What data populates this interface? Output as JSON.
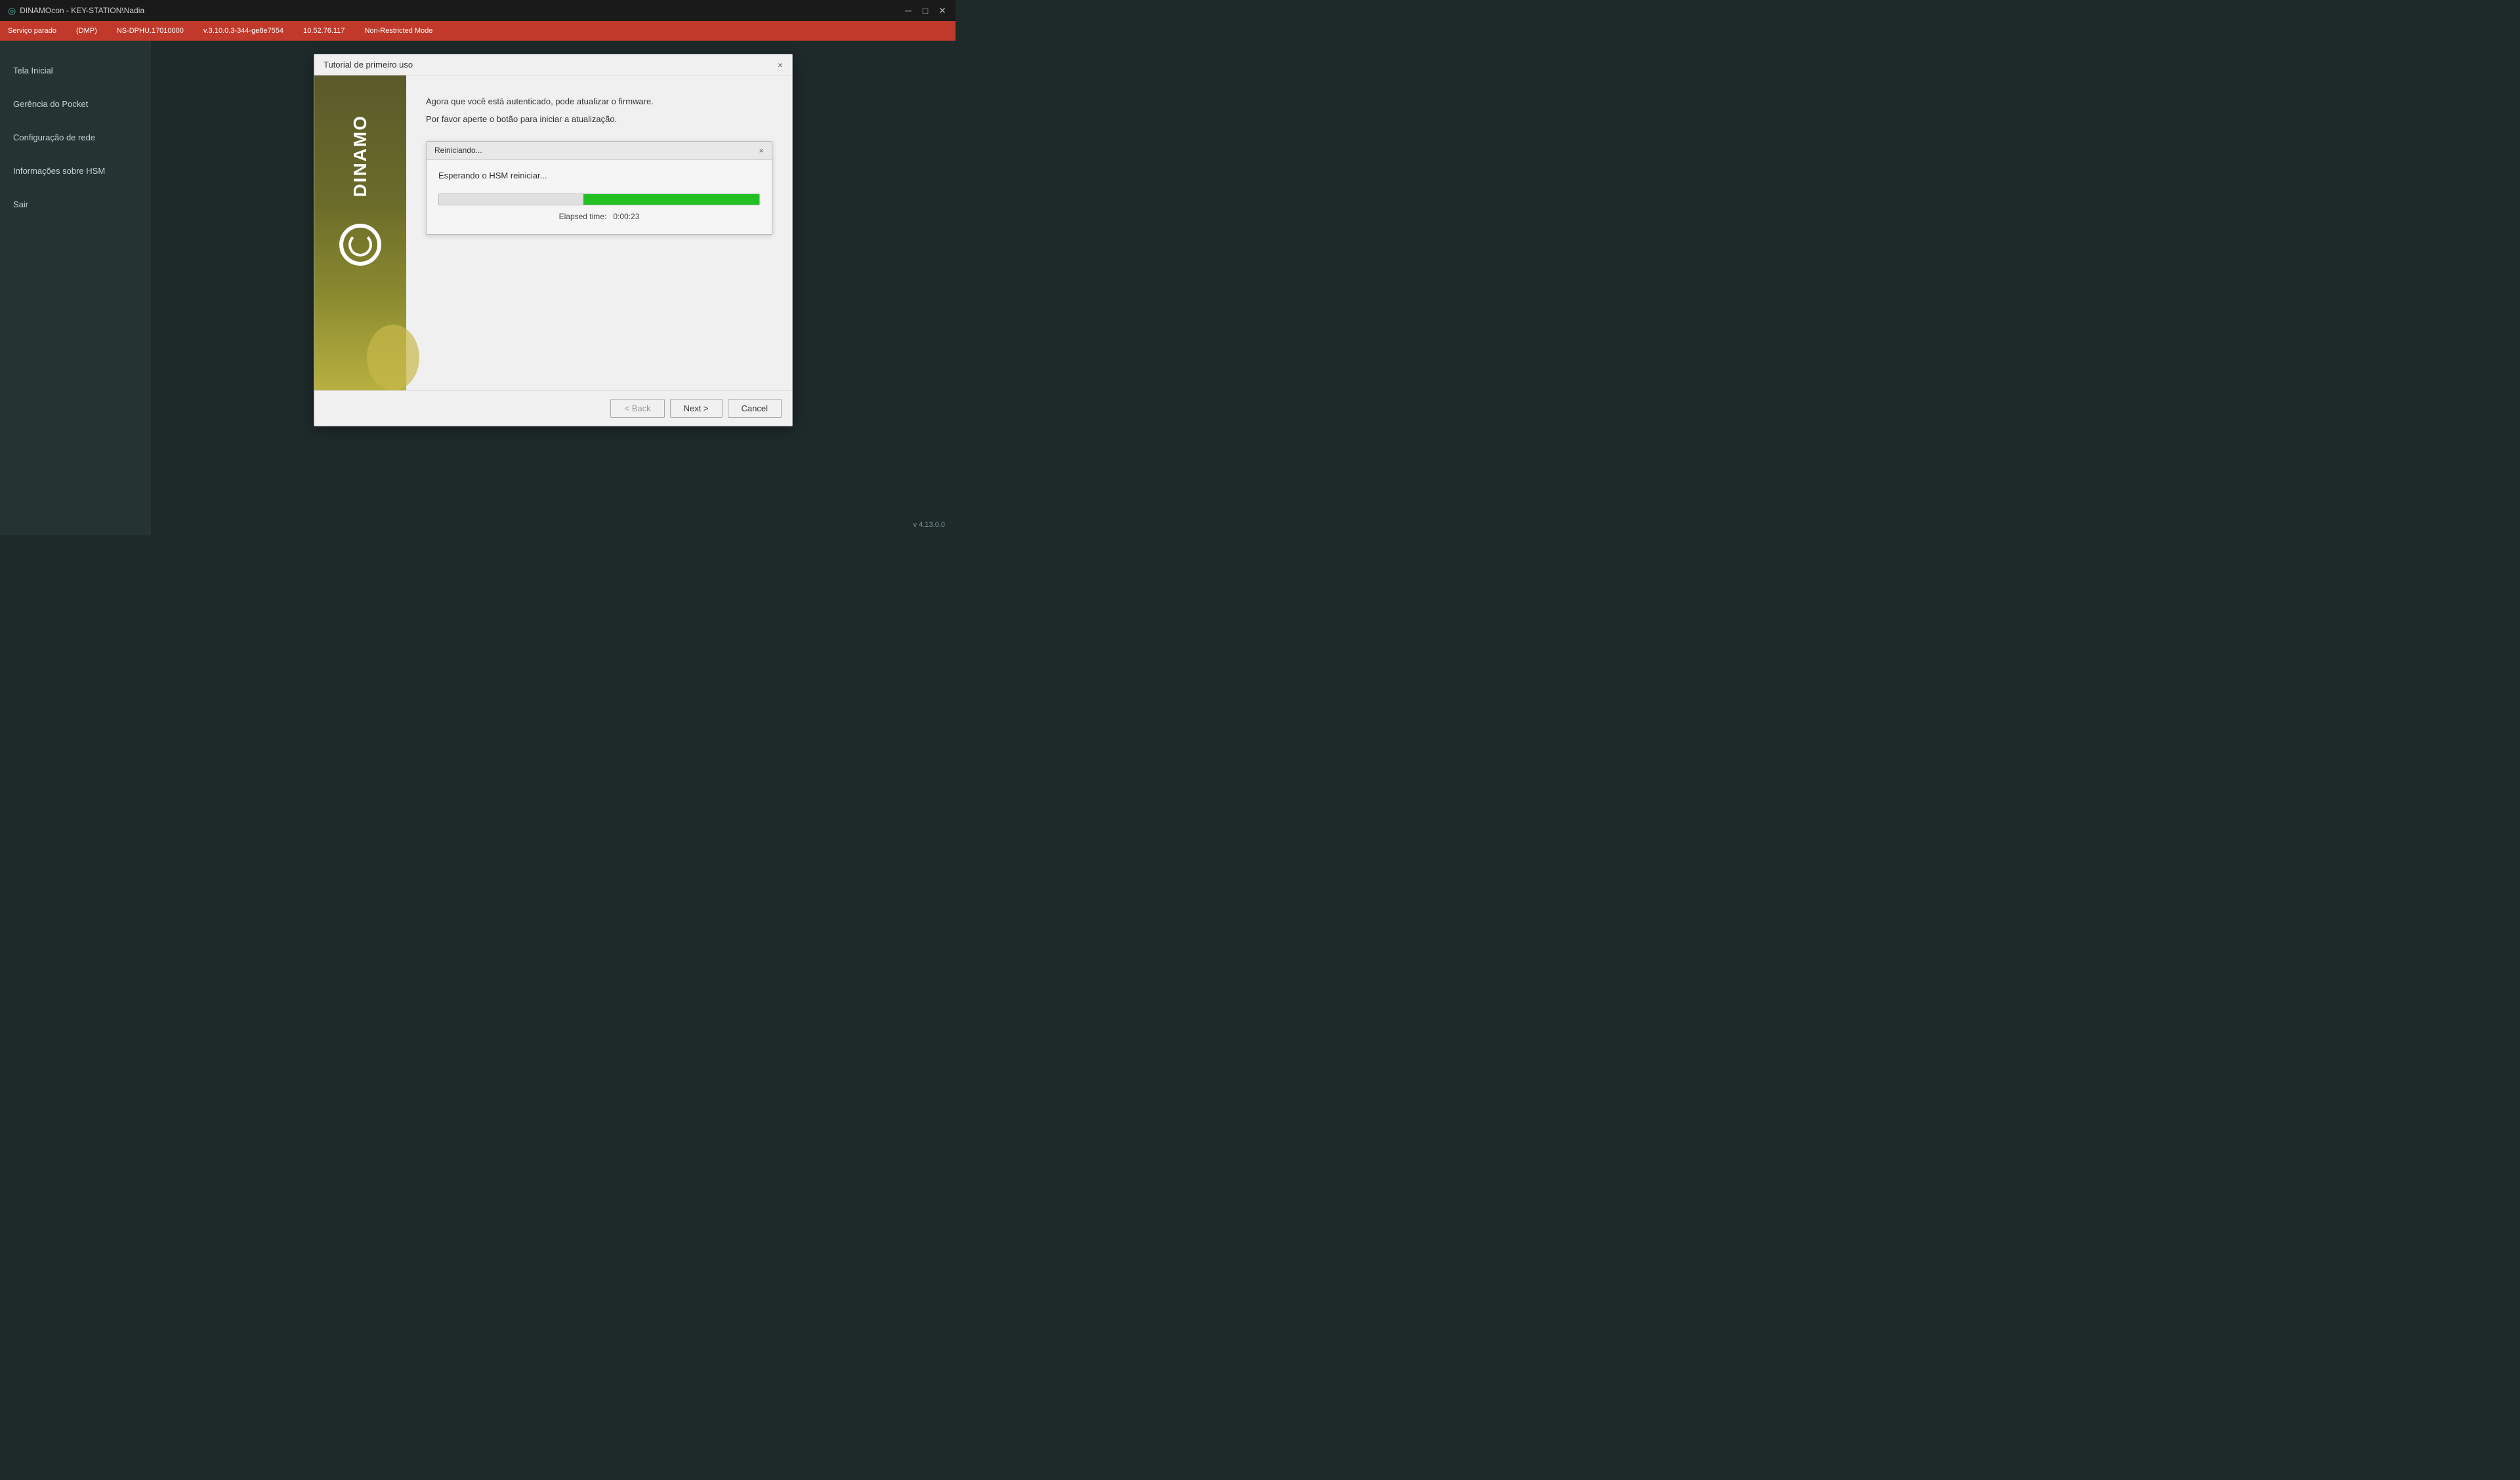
{
  "window": {
    "title": "DINAMOcon - KEY-STATION\\Nadia"
  },
  "header": {
    "service_status": "Serviço parado",
    "items": [
      "(DMP)",
      "NS-DPHU.17010000",
      "v.3.10.0.3-344-ge8e7554",
      "10.52.76.117",
      "Non-Restricted Mode"
    ]
  },
  "sidebar": {
    "items": [
      {
        "label": "Tela Inicial"
      },
      {
        "label": "Gerência do Pocket"
      },
      {
        "label": "Configuração de rede"
      },
      {
        "label": "Informações sobre HSM"
      },
      {
        "label": "Sair"
      }
    ]
  },
  "version": "v 4.13.0.0",
  "main_dialog": {
    "title": "Tutorial de primeiro uso",
    "close_label": "×",
    "logo_text": "DINAMO",
    "content_line1": "Agora que você está autenticado, pode atualizar o firmware.",
    "content_line2": "Por favor aperte o botão para iniciar a atualização.",
    "inner_dialog": {
      "title": "Reiniciando...",
      "close_label": "×",
      "message": "Esperando o HSM reiniciar...",
      "progress_percent": 55,
      "elapsed_label": "Elapsed time:",
      "elapsed_value": "0:00:23"
    },
    "footer": {
      "back_label": "< Back",
      "next_label": "Next >",
      "cancel_label": "Cancel"
    }
  }
}
